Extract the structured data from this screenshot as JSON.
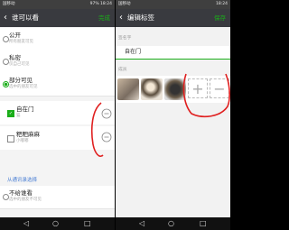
{
  "left": {
    "status": {
      "carrier": "国移动",
      "right": "97% 18:24"
    },
    "header": {
      "back_icon": "back-arrow-icon",
      "title": "谁可以看",
      "done": "完成"
    },
    "options": [
      {
        "title": "公开",
        "subtitle": "所有朋友可见",
        "selected": false
      },
      {
        "title": "私密",
        "subtitle": "仅自己可见",
        "selected": false
      },
      {
        "title": "部分可见",
        "subtitle": "选中的朋友可见",
        "selected": true
      },
      {
        "title": "不给谁看",
        "subtitle": "选中的朋友不可见",
        "selected": false
      }
    ],
    "tags": [
      {
        "name": "自在门",
        "sub": "猫",
        "checked": true
      },
      {
        "name": "粑粑麻麻",
        "sub": "小嘟嘟",
        "checked": false
      }
    ],
    "link": "从通讯录选择",
    "annotation_color": "#e02020"
  },
  "right": {
    "status": {
      "carrier": "国移动",
      "right": "18:24"
    },
    "header": {
      "back_icon": "back-arrow-icon",
      "title": "编辑标签",
      "save": "保存"
    },
    "section_name": "签名字",
    "tag_name": "自在门",
    "section_members": "成员",
    "add_icon": "plus-icon",
    "remove_icon": "minus-icon",
    "accent": "#1aad19"
  }
}
